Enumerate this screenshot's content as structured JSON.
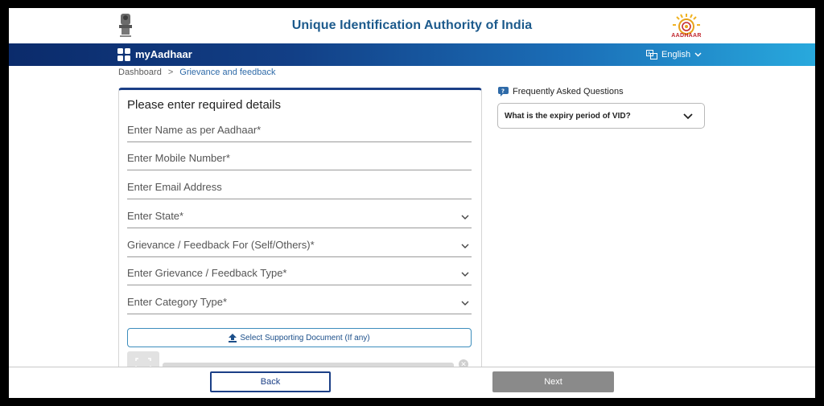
{
  "header": {
    "title": "Unique Identification Authority of India",
    "logo_text": "AADHAAR",
    "emblem_icon": "national-emblem-icon"
  },
  "nav": {
    "brand": "myAadhaar",
    "language": "English"
  },
  "breadcrumb": {
    "home": "Dashboard",
    "separator": ">",
    "current": "Grievance and feedback"
  },
  "form": {
    "title": "Please enter required details",
    "fields": [
      {
        "placeholder": "Enter Name as per Aadhaar*",
        "type": "text"
      },
      {
        "placeholder": "Enter Mobile Number*",
        "type": "text"
      },
      {
        "placeholder": "Enter Email Address",
        "type": "text"
      },
      {
        "placeholder": "Enter State*",
        "type": "select"
      },
      {
        "placeholder": "Grievance / Feedback For (Self/Others)*",
        "type": "select"
      },
      {
        "placeholder": "Enter Grievance / Feedback Type*",
        "type": "select"
      },
      {
        "placeholder": "Enter Category Type*",
        "type": "select"
      }
    ],
    "upload_label": "Select Supporting Document (If any)"
  },
  "faq": {
    "title": "Frequently Asked Questions",
    "question": "What is the expiry period of VID?"
  },
  "footer": {
    "back_label": "Back",
    "next_label": "Next"
  },
  "colors": {
    "primary": "#1b3f86",
    "title_blue": "#1c5a8c",
    "link_blue": "#2e6aa8",
    "disabled_gray": "#8a8a8a"
  }
}
